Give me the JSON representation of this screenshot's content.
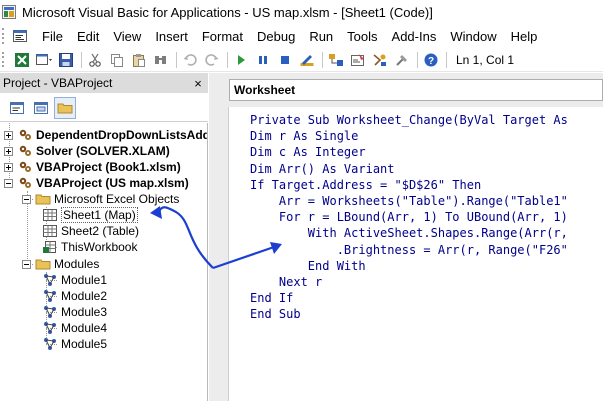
{
  "window": {
    "title": "Microsoft Visual Basic for Applications - US map.xlsm - [Sheet1 (Code)]"
  },
  "menu": {
    "items": [
      {
        "label": "File",
        "name": "file"
      },
      {
        "label": "Edit",
        "name": "edit"
      },
      {
        "label": "View",
        "name": "view"
      },
      {
        "label": "Insert",
        "name": "insert"
      },
      {
        "label": "Format",
        "name": "format"
      },
      {
        "label": "Debug",
        "name": "debug"
      },
      {
        "label": "Run",
        "name": "run"
      },
      {
        "label": "Tools",
        "name": "tools"
      },
      {
        "label": "Add-Ins",
        "name": "addins"
      },
      {
        "label": "Window",
        "name": "window"
      },
      {
        "label": "Help",
        "name": "help"
      }
    ]
  },
  "toolbar": {
    "status": "Ln 1, Col 1"
  },
  "project": {
    "title": "Project - VBAProject",
    "close_label": "×",
    "tree": [
      {
        "label": "DependentDropDownListsAdd",
        "bold": true,
        "kind": "project",
        "expander": "plus"
      },
      {
        "label": "Solver (SOLVER.XLAM)",
        "bold": true,
        "kind": "project",
        "expander": "plus"
      },
      {
        "label": "VBAProject (Book1.xlsm)",
        "bold": true,
        "kind": "project",
        "expander": "plus"
      },
      {
        "label": "VBAProject (US map.xlsm)",
        "bold": true,
        "kind": "project",
        "expander": "minus"
      },
      {
        "label": "Microsoft Excel Objects",
        "bold": false,
        "kind": "folder",
        "expander": "minus"
      },
      {
        "label": "Sheet1 (Map)",
        "bold": false,
        "kind": "sheet",
        "selected": true
      },
      {
        "label": "Sheet2 (Table)",
        "bold": false,
        "kind": "sheet"
      },
      {
        "label": "ThisWorkbook",
        "bold": false,
        "kind": "workbook"
      },
      {
        "label": "Modules",
        "bold": false,
        "kind": "folder",
        "expander": "minus"
      },
      {
        "label": "Module1",
        "bold": false,
        "kind": "module"
      },
      {
        "label": "Module2",
        "bold": false,
        "kind": "module"
      },
      {
        "label": "Module3",
        "bold": false,
        "kind": "module"
      },
      {
        "label": "Module4",
        "bold": false,
        "kind": "module"
      },
      {
        "label": "Module5",
        "bold": false,
        "kind": "module"
      }
    ]
  },
  "code": {
    "object": "Worksheet",
    "lines": [
      [
        {
          "t": "Private Sub Worksheet_Change(ByVal Target As",
          "c": "kw"
        }
      ],
      [
        {
          "t": "Dim r As Single",
          "c": "kw"
        }
      ],
      [
        {
          "t": "Dim c As Integer",
          "c": "kw"
        }
      ],
      [
        {
          "t": "Dim Arr() As Variant",
          "c": "kw"
        }
      ],
      [
        {
          "t": "If Target.Address = \"$D$26\" Then",
          "c": "kw"
        }
      ],
      [
        {
          "t": "    Arr = Worksheets(\"Table\").Range(\"Table1\"",
          "c": "kw"
        }
      ],
      [
        {
          "t": "    For r = LBound(Arr, 1) To UBound(Arr, 1)",
          "c": "kw"
        }
      ],
      [
        {
          "t": "        With ActiveSheet.Shapes.Range(Arr(r,",
          "c": "kw"
        }
      ],
      [
        {
          "t": "            .Brightness = Arr(r, Range(\"F26\"",
          "c": "kw"
        }
      ],
      [
        {
          "t": "        End With",
          "c": "kw"
        }
      ],
      [
        {
          "t": "    Next r",
          "c": "kw"
        }
      ],
      [
        {
          "t": "End If",
          "c": "kw"
        }
      ],
      [
        {
          "t": "End Sub",
          "c": "kw"
        }
      ]
    ]
  },
  "colors": {
    "keyword": "#00008b",
    "arrow": "#1c3fd1"
  }
}
